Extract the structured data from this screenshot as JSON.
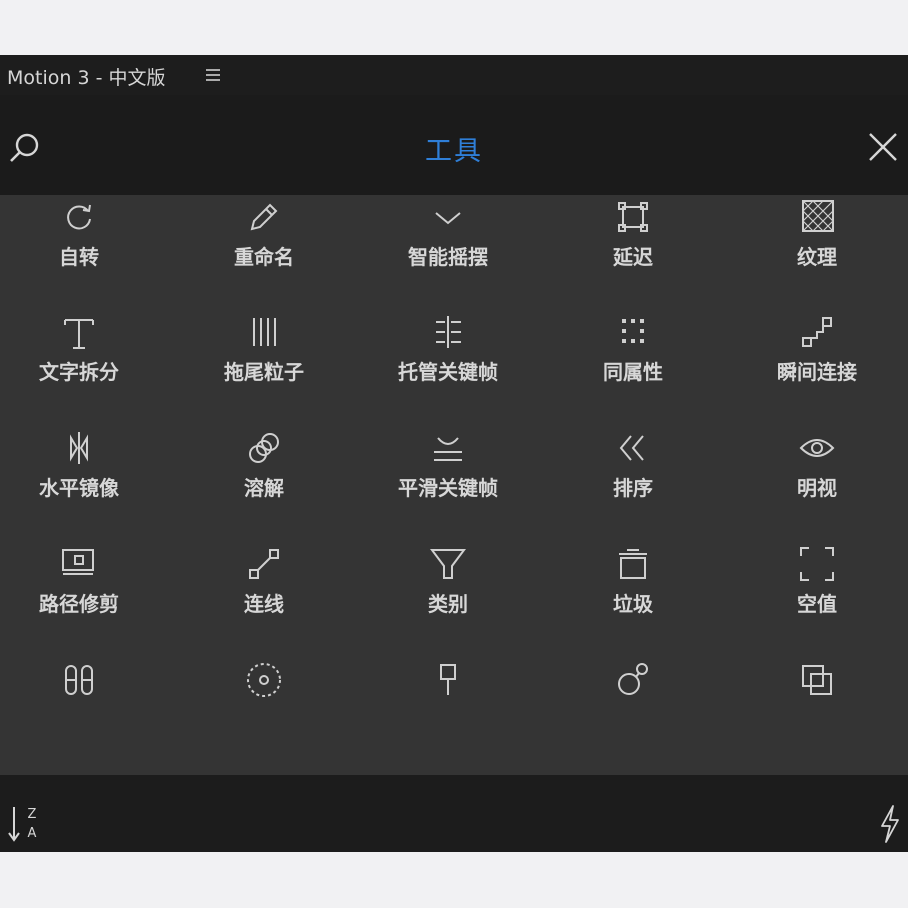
{
  "window": {
    "title": "Motion 3 - 中文版"
  },
  "header": {
    "title": "工具"
  },
  "colors": {
    "accent": "#2f7fd8",
    "panel": "#343434",
    "text": "#d7d7d7"
  },
  "tools": [
    {
      "label": "自转",
      "icon": "rotate-icon"
    },
    {
      "label": "重命名",
      "icon": "pencil-icon"
    },
    {
      "label": "智能摇摆",
      "icon": "wiggle-icon"
    },
    {
      "label": "延迟",
      "icon": "bounding-box-icon"
    },
    {
      "label": "纹理",
      "icon": "texture-icon"
    },
    {
      "label": "文字拆分",
      "icon": "text-icon"
    },
    {
      "label": "拖尾粒子",
      "icon": "trail-lines-icon"
    },
    {
      "label": "托管关键帧",
      "icon": "keyframe-align-icon"
    },
    {
      "label": "同属性",
      "icon": "dot-grid-icon"
    },
    {
      "label": "瞬间连接",
      "icon": "steps-icon"
    },
    {
      "label": "水平镜像",
      "icon": "mirror-icon"
    },
    {
      "label": "溶解",
      "icon": "chain-link-icon"
    },
    {
      "label": "平滑关键帧",
      "icon": "smooth-curve-icon"
    },
    {
      "label": "排序",
      "icon": "double-chevron-left-icon"
    },
    {
      "label": "明视",
      "icon": "eye-icon"
    },
    {
      "label": "路径修剪",
      "icon": "trim-path-icon"
    },
    {
      "label": "连线",
      "icon": "connect-line-icon"
    },
    {
      "label": "类别",
      "icon": "funnel-icon"
    },
    {
      "label": "垃圾",
      "icon": "trash-icon"
    },
    {
      "label": "空值",
      "icon": "null-frame-icon"
    },
    {
      "label": "",
      "icon": "pills-icon"
    },
    {
      "label": "",
      "icon": "dashed-circle-icon"
    },
    {
      "label": "",
      "icon": "pin-icon"
    },
    {
      "label": "",
      "icon": "circle-arrow-icon"
    },
    {
      "label": "",
      "icon": "duplicate-icon"
    }
  ],
  "footer": {
    "sort_icon": "sort-za-icon",
    "action_icon": "lightning-icon"
  }
}
